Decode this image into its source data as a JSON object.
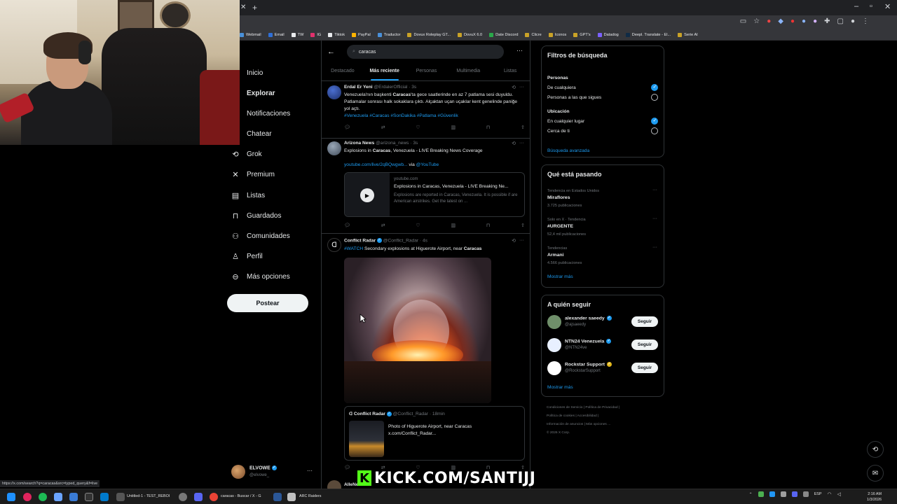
{
  "browser": {
    "bookmarks": [
      "Webmail",
      "Email",
      "TW",
      "IG",
      "Tiktok",
      "PayPal",
      "Traductor",
      "Dovux Roleplay GT...",
      "DovuX 6.0",
      "Date Discord",
      "Clicre",
      "Iconos",
      "GPT's",
      "Datadog",
      "Deepl. Translate - El...",
      "Serie AI"
    ],
    "bookmark_colors": [
      "#4a90d9",
      "#2f6fd6",
      "#e8eaed",
      "#e1306c",
      "#e8eaed",
      "#ffb400",
      "#4a90d9",
      "#c9a227",
      "#c9a227",
      "#2aa84a",
      "#c9a227",
      "#c9a227",
      "#c9a227",
      "#7b61ff",
      "#0f2b46",
      "#c9a227"
    ],
    "status_url": "https://x.com/search?q=caracas&src=typed_query&f=live"
  },
  "nav": {
    "items": [
      {
        "icon": "home-icon",
        "label": "Inicio"
      },
      {
        "icon": "explore-icon",
        "label": "Explorar"
      },
      {
        "icon": "bell-icon",
        "label": "Notificaciones"
      },
      {
        "icon": "mail-icon",
        "label": "Chatear"
      },
      {
        "icon": "grok-icon",
        "label": "Grok"
      },
      {
        "icon": "x-logo-icon",
        "label": "Premium"
      },
      {
        "icon": "list-icon",
        "label": "Listas"
      },
      {
        "icon": "bookmark-icon",
        "label": "Guardados"
      },
      {
        "icon": "communities-icon",
        "label": "Comunidades"
      },
      {
        "icon": "profile-icon",
        "label": "Perfil"
      },
      {
        "icon": "more-circle-icon",
        "label": "Más opciones"
      }
    ],
    "post_label": "Postear",
    "account": {
      "name": "ELVOWE",
      "handle": "@elvowe_"
    }
  },
  "search": {
    "query": "caracas",
    "tabs": [
      "Destacado",
      "Más reciente",
      "Personas",
      "Multimedia",
      "Listas"
    ],
    "active_tab": "Más reciente"
  },
  "tweets": [
    {
      "name": "Erdal Er Yeni",
      "handle": "@ErdalerOfficial",
      "time": "3s",
      "text_parts": [
        "Venezuela'nın başkenti ",
        "Caracas",
        "'ta gece saatlerinde en az 7 patlama sesi duyuldu. Patlamalar sonrası halk sokaklara çıktı. Alçaktan uçan uçaklar kent genelinde paniğe yol açtı."
      ],
      "hashtags": "#Venezuela #Caracas #SonDakika #Patlama #Güvenlik"
    },
    {
      "name": "Arizona News",
      "handle": "@arizona_news",
      "time": "3s",
      "text_parts": [
        "Explosions in ",
        "Caracas",
        ", Venezuela - LIVE Breaking News Coverage"
      ],
      "link": "youtube.com/live/2qBQwgwb...",
      "via": " via ",
      "via_handle": "@YouTube",
      "card": {
        "domain": "youtube.com",
        "title": "Explosions in Caracas, Venezuela - LIVE Breaking Ne...",
        "desc": "Explosions are reported in Caracas, Venezuela. It is possible if are American airstrikes. Get the latest on ..."
      }
    },
    {
      "name": "Conflict Radar",
      "handle": "@Conflict_Radar",
      "time": "4s",
      "hashtag": "#WATCH",
      "text_parts": [
        " Secondary explosions at Higuerote Airport, near ",
        "Caracas"
      ],
      "quote": {
        "name": "Conflict Radar",
        "handle": "@Conflict_Radar",
        "time": "18min",
        "text_line1": "Photo of Higuerote Airport, near Caracas",
        "text_line2": "x.com/Conflict_Radar..."
      }
    },
    {
      "name": "AlleNews"
    }
  ],
  "filters": {
    "title": "Filtros de búsqueda",
    "people_title": "Personas",
    "people_options": [
      "De cualquiera",
      "Personas a las que sigues"
    ],
    "people_selected": 0,
    "location_title": "Ubicación",
    "location_options": [
      "En cualquier lugar",
      "Cerca de ti"
    ],
    "location_selected": 0,
    "advanced_link": "Búsqueda avanzada"
  },
  "trends": {
    "title": "Qué está pasando",
    "items": [
      {
        "meta": "Tendencia en Estados Unidos",
        "name": "Miraflores",
        "count": "3.725 publicaciones"
      },
      {
        "meta": "Solo en X · Tendencia",
        "name": "#URGENTE",
        "count": "52,4 mil publicaciones"
      },
      {
        "meta": "Tendencias",
        "name": "Armani",
        "count": "4.566 publicaciones"
      }
    ],
    "show_more": "Mostrar más"
  },
  "who_to_follow": {
    "title": "A quién seguir",
    "items": [
      {
        "name": "alexander saeedy",
        "handle": "@ajsaeedy",
        "badge": "blue",
        "avatar_color": "#6f8f6a"
      },
      {
        "name": "NTN24 Venezuela",
        "handle": "@NTN24ve",
        "badge": "blue",
        "avatar_color": "#e8f0ff"
      },
      {
        "name": "Rockstar Support",
        "handle": "@RockstarSupport",
        "badge": "gold",
        "avatar_color": "#ffffff"
      }
    ],
    "follow_label": "Seguir",
    "show_more": "Mostrar más"
  },
  "footer": {
    "lines": [
      "Condiciones de Servicio  |  Política de Privacidad  |",
      "Política de cookies  |  Accesibilidad  |",
      "Información de anuncios  |  Más opciones ...",
      "© 2026 X Corp."
    ]
  },
  "overlay": {
    "kick_text": "KICK.COM/SANTIJJ"
  },
  "taskbar": {
    "items": [
      "Untitled-1 - TEST_REBOI",
      "caracas - Buscar / X - G",
      "ARC Raiders"
    ],
    "lang": "ESP",
    "time": "2:16 AM",
    "date": "1/3/2026"
  }
}
